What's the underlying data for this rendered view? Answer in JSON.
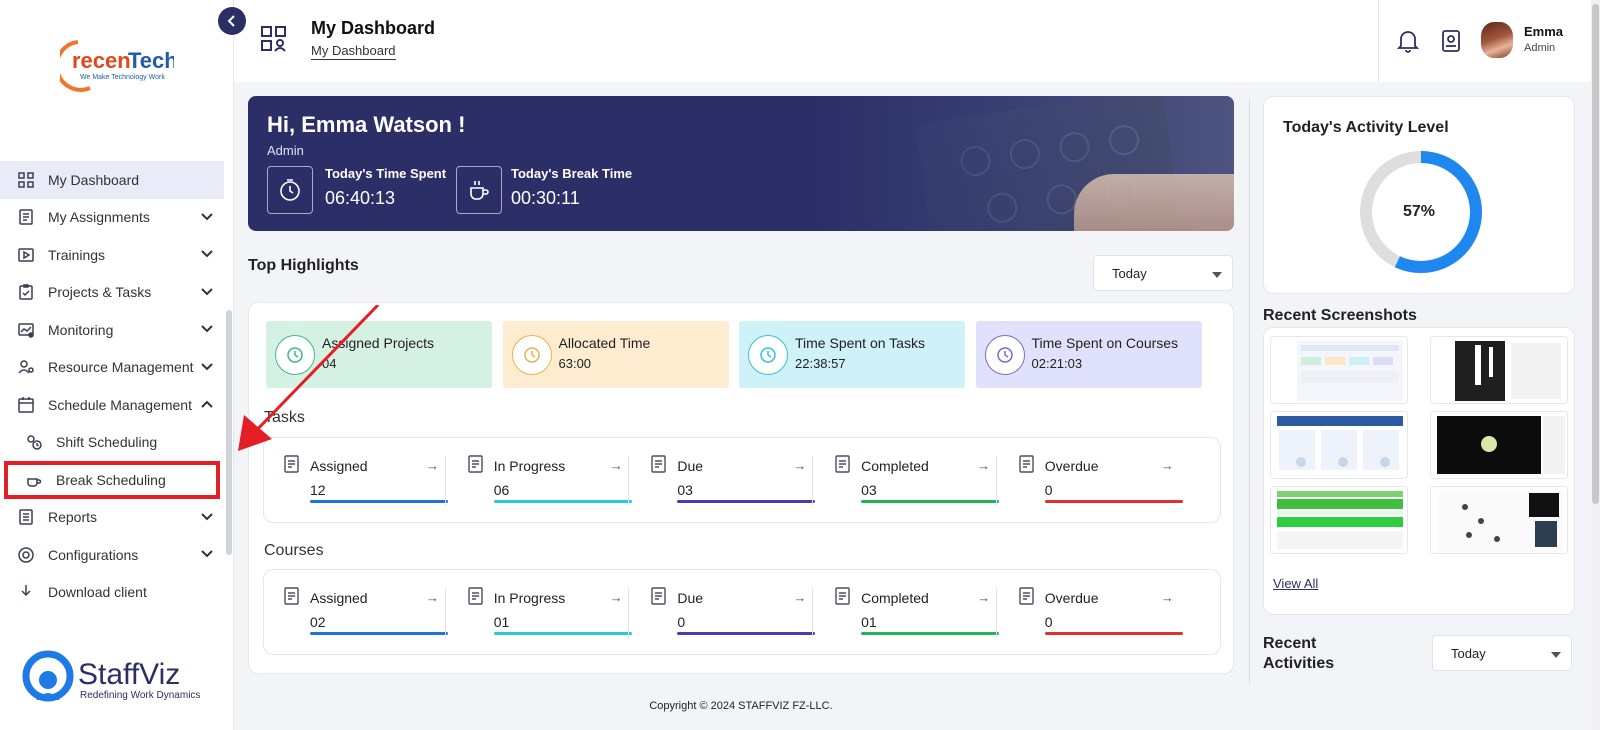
{
  "brand": {
    "top_logo_name": "recenTech",
    "top_logo_tagline": "We Make Technology Work",
    "bottom_logo_name": "StaffViz",
    "bottom_logo_tagline": "Redefining Work Dynamics"
  },
  "sidebar": {
    "items": [
      {
        "label": "My Dashboard",
        "icon": "dashboard-grid-icon",
        "active": true
      },
      {
        "label": "My Assignments",
        "icon": "assignments-icon",
        "chevron": "down"
      },
      {
        "label": "Trainings",
        "icon": "training-video-icon",
        "chevron": "down"
      },
      {
        "label": "Projects & Tasks",
        "icon": "clipboard-check-icon",
        "chevron": "down"
      },
      {
        "label": "Monitoring",
        "icon": "monitoring-chart-icon",
        "chevron": "down"
      },
      {
        "label": "Resource Management",
        "icon": "resource-user-icon",
        "chevron": "down"
      },
      {
        "label": "Schedule Management",
        "icon": "schedule-icon",
        "chevron": "up"
      },
      {
        "label": "Shift Scheduling",
        "icon": "shift-icon",
        "sub": true
      },
      {
        "label": "Break Scheduling",
        "icon": "break-icon",
        "sub": true,
        "highlighted": true
      },
      {
        "label": "Reports",
        "icon": "reports-icon",
        "chevron": "down"
      },
      {
        "label": "Configurations",
        "icon": "configurations-icon",
        "chevron": "down"
      },
      {
        "label": "Download client",
        "icon": "download-icon"
      }
    ]
  },
  "header": {
    "title": "My Dashboard",
    "breadcrumb": "My Dashboard",
    "user_name": "Emma",
    "user_role": "Admin"
  },
  "banner": {
    "greeting": "Hi, Emma Watson !",
    "role": "Admin",
    "time_spent_label": "Today's Time Spent",
    "time_spent_value": "06:40:13",
    "break_time_label": "Today's Break Time",
    "break_time_value": "00:30:11"
  },
  "highlights": {
    "title": "Top Highlights",
    "filter": "Today",
    "cards": [
      {
        "label": "Assigned Projects",
        "value": "04",
        "bg": "#d5f1e4",
        "ring": "#3fb98a"
      },
      {
        "label": "Allocated Time",
        "value": "63:00",
        "bg": "#fdeccf",
        "ring": "#f0b04a"
      },
      {
        "label": "Time Spent on Tasks",
        "value": "22:38:57",
        "bg": "#cff1f8",
        "ring": "#34c1db"
      },
      {
        "label": "Time Spent on Courses",
        "value": "02:21:03",
        "bg": "#e0e1fb",
        "ring": "#6f6fd6"
      }
    ]
  },
  "tasks": {
    "title": "Tasks",
    "tiles": [
      {
        "label": "Assigned",
        "value": "12",
        "color": "#1e74d4"
      },
      {
        "label": "In Progress",
        "value": "06",
        "color": "#2ec5e0"
      },
      {
        "label": "Due",
        "value": "03",
        "color": "#4b3cb5"
      },
      {
        "label": "Completed",
        "value": "03",
        "color": "#22b35a"
      },
      {
        "label": "Overdue",
        "value": "0",
        "color": "#e03131"
      }
    ]
  },
  "courses": {
    "title": "Courses",
    "tiles": [
      {
        "label": "Assigned",
        "value": "02",
        "color": "#1e74d4"
      },
      {
        "label": "In Progress",
        "value": "01",
        "color": "#2ec5e0"
      },
      {
        "label": "Due",
        "value": "0",
        "color": "#4b3cb5"
      },
      {
        "label": "Completed",
        "value": "01",
        "color": "#22b35a"
      },
      {
        "label": "Overdue",
        "value": "0",
        "color": "#e03131"
      }
    ]
  },
  "activity": {
    "title": "Today's Activity Level",
    "percent_label": "57%",
    "percent": 57,
    "color": "#1e88f0"
  },
  "screenshots": {
    "title": "Recent Screenshots",
    "view_all": "View All"
  },
  "recent_activities": {
    "title_line1": "Recent",
    "title_line2": "Activities",
    "filter": "Today"
  },
  "footer": {
    "copyright": "Copyright © 2024 STAFFVIZ FZ-LLC."
  }
}
